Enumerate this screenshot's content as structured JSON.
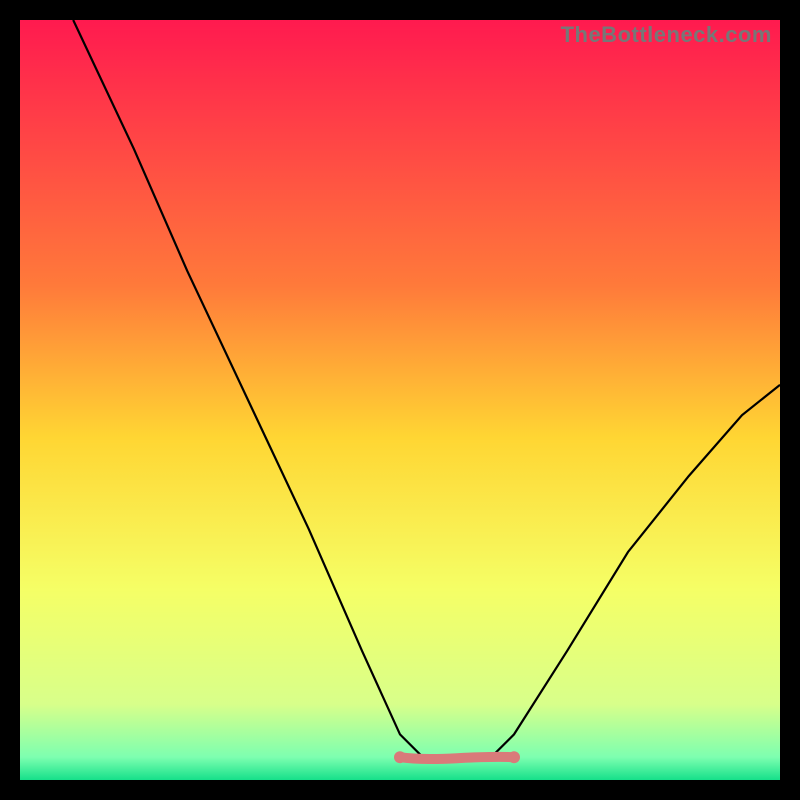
{
  "watermark": "TheBottleneck.com",
  "chart_data": {
    "type": "line",
    "xlim": [
      0,
      100
    ],
    "ylim": [
      0,
      100
    ],
    "title": "",
    "xlabel": "",
    "ylabel": "",
    "gradient_stops": [
      {
        "offset": 0,
        "color": "#ff1a4f"
      },
      {
        "offset": 35,
        "color": "#ff7a3a"
      },
      {
        "offset": 55,
        "color": "#ffd633"
      },
      {
        "offset": 75,
        "color": "#f5ff66"
      },
      {
        "offset": 90,
        "color": "#d8ff8a"
      },
      {
        "offset": 97,
        "color": "#7dffb0"
      },
      {
        "offset": 100,
        "color": "#16e08a"
      }
    ],
    "curve_points": [
      {
        "x": 7,
        "y": 100
      },
      {
        "x": 15,
        "y": 83
      },
      {
        "x": 22,
        "y": 67
      },
      {
        "x": 30,
        "y": 50
      },
      {
        "x": 38,
        "y": 33
      },
      {
        "x": 45,
        "y": 17
      },
      {
        "x": 50,
        "y": 6
      },
      {
        "x": 53,
        "y": 3
      },
      {
        "x": 58,
        "y": 3
      },
      {
        "x": 62,
        "y": 3
      },
      {
        "x": 65,
        "y": 6
      },
      {
        "x": 72,
        "y": 17
      },
      {
        "x": 80,
        "y": 30
      },
      {
        "x": 88,
        "y": 40
      },
      {
        "x": 95,
        "y": 48
      },
      {
        "x": 100,
        "y": 52
      }
    ],
    "series": [
      {
        "name": "bottleneck-curve",
        "color": "#000000",
        "width": 2
      },
      {
        "name": "optimal-band",
        "color": "#d97a7a",
        "width": 10,
        "x_range": [
          50,
          65
        ],
        "y": 3
      }
    ]
  }
}
